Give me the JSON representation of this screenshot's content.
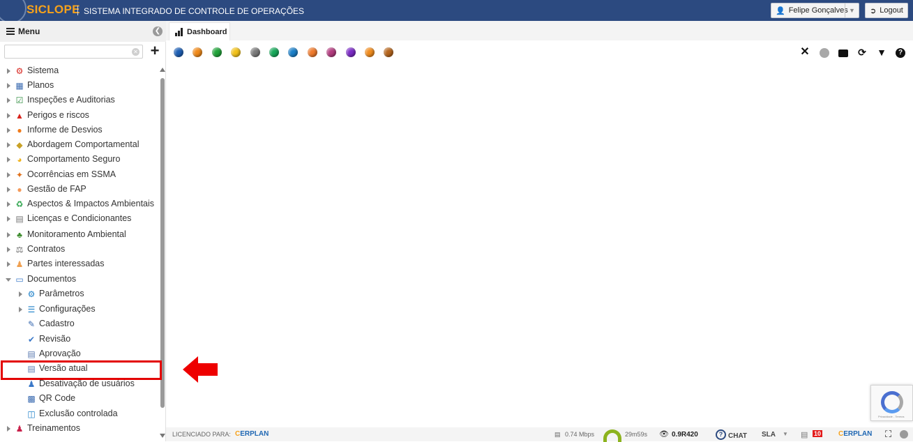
{
  "header": {
    "brand": "SICLOPE",
    "system_title": "SISTEMA INTEGRADO DE CONTROLE DE OPERAÇÕES",
    "user_name": "Felipe Gonçalves",
    "logout_label": "Logout"
  },
  "sidebar": {
    "title": "Menu",
    "search_placeholder": "",
    "items": [
      {
        "label": "Sistema",
        "icon": "gear-icon"
      },
      {
        "label": "Planos",
        "icon": "calendar-icon"
      },
      {
        "label": "Inspeções e Auditorias",
        "icon": "checklist-icon"
      },
      {
        "label": "Perigos e riscos",
        "icon": "warning-icon"
      },
      {
        "label": "Informe de Desvios",
        "icon": "phone-icon"
      },
      {
        "label": "Abordagem Comportamental",
        "icon": "diamond-icon"
      },
      {
        "label": "Comportamento Seguro",
        "icon": "helmet-icon"
      },
      {
        "label": "Ocorrências em SSMA",
        "icon": "fall-icon"
      },
      {
        "label": "Gestão de FAP",
        "icon": "circle-icon"
      },
      {
        "label": "Aspectos & Impactos Ambientais",
        "icon": "recycle-icon"
      },
      {
        "label": "Licenças e Condicionantes",
        "icon": "document-icon"
      },
      {
        "label": "Monitoramento Ambiental",
        "icon": "tree-icon"
      },
      {
        "label": "Contratos",
        "icon": "scale-icon"
      },
      {
        "label": "Partes interessadas",
        "icon": "people-icon"
      },
      {
        "label": "Documentos",
        "icon": "folder-icon"
      },
      {
        "label": "Parâmetros",
        "icon": "gear-blue-icon"
      },
      {
        "label": "Configurações",
        "icon": "sliders-icon"
      },
      {
        "label": "Cadastro",
        "icon": "edit-doc-icon"
      },
      {
        "label": "Revisão",
        "icon": "thumbs-up-icon"
      },
      {
        "label": "Aprovação",
        "icon": "approve-doc-icon"
      },
      {
        "label": "Versão atual",
        "icon": "current-doc-icon"
      },
      {
        "label": "Desativação de usuários",
        "icon": "users-icon"
      },
      {
        "label": "QR Code",
        "icon": "qrcode-icon"
      },
      {
        "label": "Exclusão controlada",
        "icon": "trash-icon"
      },
      {
        "label": "Treinamentos",
        "icon": "trainer-icon"
      }
    ]
  },
  "main": {
    "tab_label": "Dashboard",
    "status_dots": [
      "#1e5fb4",
      "#f08a1a",
      "#21a33a",
      "#f2c21b",
      "#7a7a7a",
      "#17a85a",
      "#1b7fc8",
      "#ef7a2c",
      "#b23b7e",
      "#7a2bc4",
      "#f08c1e",
      "#b5651d"
    ],
    "toolbar_icons": [
      "close-icon",
      "status-gray-icon",
      "monitor-icon",
      "refresh-icon",
      "filter-icon",
      "help-icon"
    ]
  },
  "footer": {
    "licensed_label": "LICENCIADO PARA:",
    "licensee_logo": "ERPLAN",
    "speed": "0.74 Mbps",
    "session_timer": "29m59s",
    "version": "0.9R420",
    "chat_label": "CHAT",
    "sla_label": "SLA",
    "notification_count": "10",
    "brand_logo": "ERPLAN"
  },
  "recaptcha": {
    "text": "Privacidade - Termos"
  },
  "colors": {
    "header_bg": "#2c4a80",
    "brand": "#f6a21b",
    "highlight": "#e30000"
  }
}
